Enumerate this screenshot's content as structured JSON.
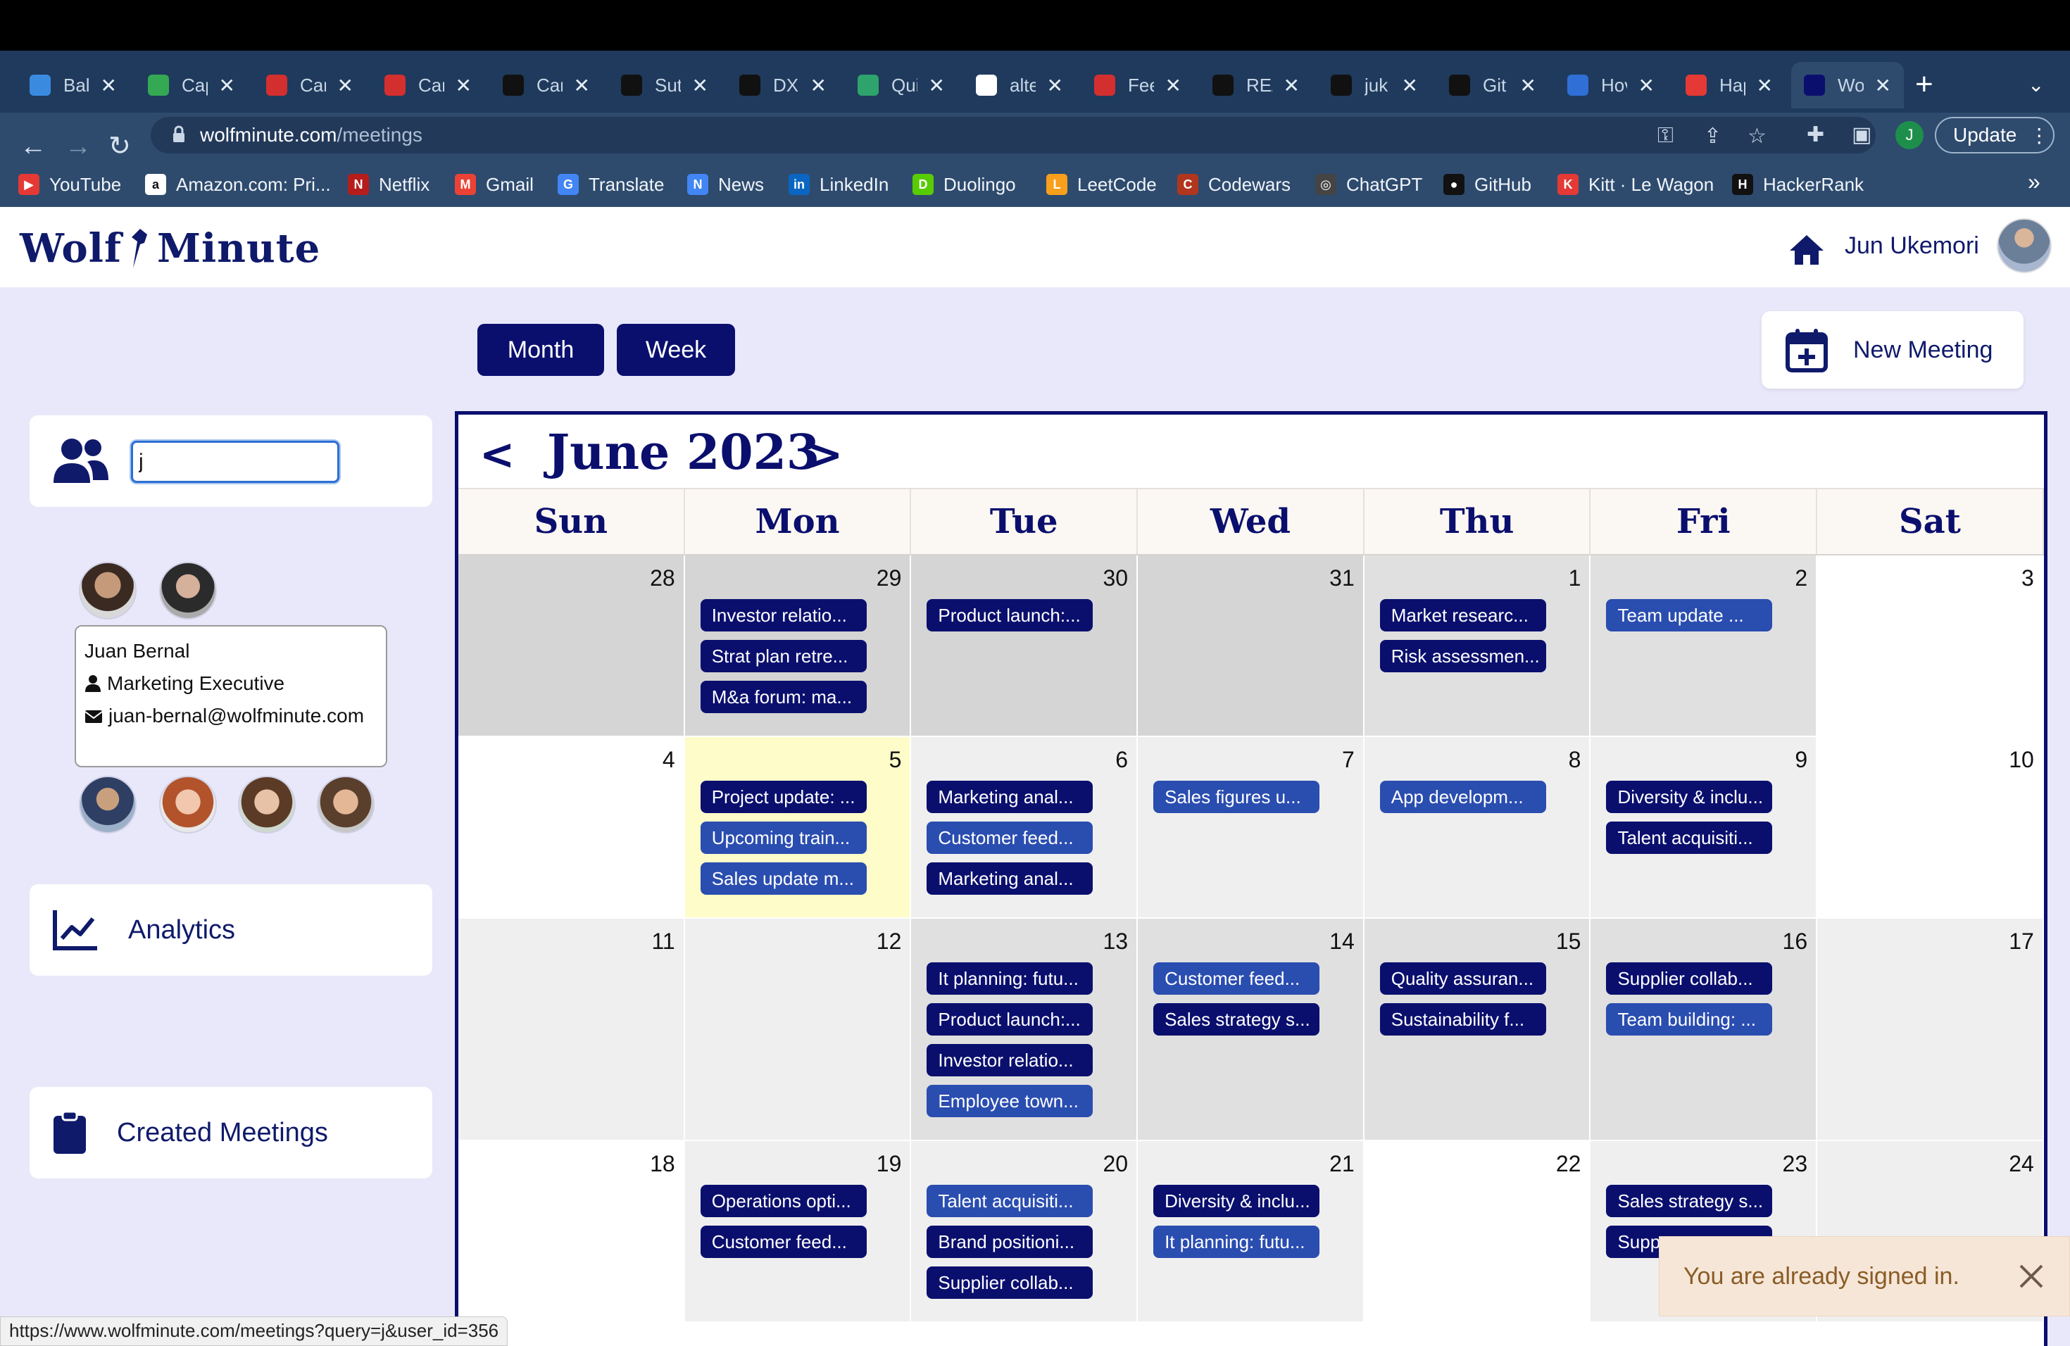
{
  "browser": {
    "tabs": [
      {
        "title": "Bali",
        "color": "#3a8be0"
      },
      {
        "title": "Cap",
        "color": "#34a853"
      },
      {
        "title": "Car",
        "color": "#d32f2f"
      },
      {
        "title": "Car",
        "color": "#d32f2f"
      },
      {
        "title": "Car",
        "color": "#111111"
      },
      {
        "title": "Sut",
        "color": "#111111"
      },
      {
        "title": "DX",
        "color": "#111111"
      },
      {
        "title": "Qui",
        "color": "#2ea36b"
      },
      {
        "title": "alte",
        "color": "#ffffff"
      },
      {
        "title": "Fee",
        "color": "#d32f2f"
      },
      {
        "title": "RE/",
        "color": "#111111"
      },
      {
        "title": "juk",
        "color": "#111111"
      },
      {
        "title": "Git",
        "color": "#111111"
      },
      {
        "title": "Hov",
        "color": "#2f6fd6"
      },
      {
        "title": "Hap",
        "color": "#e53935"
      },
      {
        "title": "Wol",
        "color": "#0a0f6e"
      }
    ],
    "url_host": "wolfminute.com",
    "url_path": "/meetings",
    "update_label": "Update",
    "profile_initial": "J",
    "bookmarks": [
      {
        "label": "YouTube",
        "color": "#e53935",
        "glyph": "▶"
      },
      {
        "label": "Amazon.com: Pri...",
        "color": "#ffffff",
        "glyph": "a"
      },
      {
        "label": "Netflix",
        "color": "#b71c1c",
        "glyph": "N"
      },
      {
        "label": "Gmail",
        "color": "#ea4335",
        "glyph": "M"
      },
      {
        "label": "Translate",
        "color": "#4285f4",
        "glyph": "G"
      },
      {
        "label": "News",
        "color": "#4285f4",
        "glyph": "N"
      },
      {
        "label": "LinkedIn",
        "color": "#0a66c2",
        "glyph": "in"
      },
      {
        "label": "Duolingo",
        "color": "#58cc02",
        "glyph": "D"
      },
      {
        "label": "LeetCode",
        "color": "#f89f1b",
        "glyph": "L"
      },
      {
        "label": "Codewars",
        "color": "#b1361e",
        "glyph": "C"
      },
      {
        "label": "ChatGPT",
        "color": "#444444",
        "glyph": "◎"
      },
      {
        "label": "GitHub",
        "color": "#111111",
        "glyph": "●"
      },
      {
        "label": "Kitt · Le Wagon",
        "color": "#e53935",
        "glyph": "K"
      },
      {
        "label": "HackerRank",
        "color": "#111111",
        "glyph": "H"
      }
    ],
    "status_url": "https://www.wolfminute.com/meetings?query=j&user_id=356"
  },
  "header": {
    "logo_left": "Wolf",
    "logo_right": "Minute",
    "user_name": "Jun Ukemori"
  },
  "views": {
    "month_label": "Month",
    "week_label": "Week",
    "new_meeting_label": "New Meeting"
  },
  "sidebar": {
    "search_value": "j",
    "tooltip": {
      "name": "Juan Bernal",
      "role": "Marketing Executive",
      "email": "juan-bernal@wolfminute.com"
    },
    "analytics_label": "Analytics",
    "created_label": "Created Meetings"
  },
  "calendar": {
    "title": "June 2023",
    "prev": "<",
    "next": ">",
    "days": [
      "Sun",
      "Mon",
      "Tue",
      "Wed",
      "Thu",
      "Fri",
      "Sat"
    ],
    "weeks": [
      [
        {
          "day": "28",
          "bg": "#d5d5d5",
          "events": []
        },
        {
          "day": "29",
          "bg": "#d5d5d5",
          "events": [
            {
              "t": "Investor relatio...",
              "k": "dark"
            },
            {
              "t": "Strat plan retre...",
              "k": "dark"
            },
            {
              "t": "M&a forum: ma...",
              "k": "dark"
            }
          ]
        },
        {
          "day": "30",
          "bg": "#d5d5d5",
          "events": [
            {
              "t": "Product launch:...",
              "k": "dark"
            }
          ]
        },
        {
          "day": "31",
          "bg": "#d5d5d5",
          "events": []
        },
        {
          "day": "1",
          "bg": "#e0e0e0",
          "events": [
            {
              "t": "Market researc...",
              "k": "dark"
            },
            {
              "t": "Risk assessmen...",
              "k": "dark"
            }
          ]
        },
        {
          "day": "2",
          "bg": "#e0e0e0",
          "events": [
            {
              "t": "Team update ...",
              "k": "light"
            }
          ]
        },
        {
          "day": "3",
          "bg": "#ffffff",
          "events": []
        }
      ],
      [
        {
          "day": "4",
          "bg": "#ffffff",
          "events": []
        },
        {
          "day": "5",
          "bg": "#fefdc9",
          "events": [
            {
              "t": "Project update: ...",
              "k": "dark"
            },
            {
              "t": "Upcoming train...",
              "k": "light"
            },
            {
              "t": "Sales update m...",
              "k": "light"
            }
          ]
        },
        {
          "day": "6",
          "bg": "#efefef",
          "events": [
            {
              "t": "Marketing anal...",
              "k": "dark"
            },
            {
              "t": "Customer feed...",
              "k": "light"
            },
            {
              "t": "Marketing anal...",
              "k": "dark"
            }
          ]
        },
        {
          "day": "7",
          "bg": "#efefef",
          "events": [
            {
              "t": "Sales figures u...",
              "k": "light"
            }
          ]
        },
        {
          "day": "8",
          "bg": "#efefef",
          "events": [
            {
              "t": "App developm...",
              "k": "light"
            }
          ]
        },
        {
          "day": "9",
          "bg": "#efefef",
          "events": [
            {
              "t": "Diversity & inclu...",
              "k": "dark"
            },
            {
              "t": "Talent acquisiti...",
              "k": "dark"
            }
          ]
        },
        {
          "day": "10",
          "bg": "#ffffff",
          "events": []
        }
      ],
      [
        {
          "day": "11",
          "bg": "#efefef",
          "events": []
        },
        {
          "day": "12",
          "bg": "#efefef",
          "events": []
        },
        {
          "day": "13",
          "bg": "#e0e0e0",
          "events": [
            {
              "t": "It planning: futu...",
              "k": "dark"
            },
            {
              "t": "Product launch:...",
              "k": "dark"
            },
            {
              "t": "Investor relatio...",
              "k": "dark"
            },
            {
              "t": "Employee town...",
              "k": "light"
            }
          ]
        },
        {
          "day": "14",
          "bg": "#e0e0e0",
          "events": [
            {
              "t": "Customer feed...",
              "k": "light"
            },
            {
              "t": "Sales strategy s...",
              "k": "dark"
            }
          ]
        },
        {
          "day": "15",
          "bg": "#e0e0e0",
          "events": [
            {
              "t": "Quality assuran...",
              "k": "dark"
            },
            {
              "t": "Sustainability f...",
              "k": "dark"
            }
          ]
        },
        {
          "day": "16",
          "bg": "#e0e0e0",
          "events": [
            {
              "t": "Supplier collab...",
              "k": "dark"
            },
            {
              "t": "Team building: ...",
              "k": "light"
            }
          ]
        },
        {
          "day": "17",
          "bg": "#efefef",
          "events": []
        }
      ],
      [
        {
          "day": "18",
          "bg": "#ffffff",
          "events": []
        },
        {
          "day": "19",
          "bg": "#efefef",
          "events": [
            {
              "t": "Operations opti...",
              "k": "dark"
            },
            {
              "t": "Customer feed...",
              "k": "dark"
            }
          ]
        },
        {
          "day": "20",
          "bg": "#efefef",
          "events": [
            {
              "t": "Talent acquisiti...",
              "k": "light"
            },
            {
              "t": "Brand positioni...",
              "k": "dark"
            },
            {
              "t": "Supplier collab...",
              "k": "dark"
            }
          ]
        },
        {
          "day": "21",
          "bg": "#efefef",
          "events": [
            {
              "t": "Diversity & inclu...",
              "k": "dark"
            },
            {
              "t": "It planning: futu...",
              "k": "light"
            }
          ]
        },
        {
          "day": "22",
          "bg": "#ffffff",
          "events": []
        },
        {
          "day": "23",
          "bg": "#efefef",
          "events": [
            {
              "t": "Sales strategy s...",
              "k": "dark"
            },
            {
              "t": "Supp",
              "k": "dark"
            }
          ]
        },
        {
          "day": "24",
          "bg": "#efefef",
          "events": []
        }
      ]
    ]
  },
  "toast": {
    "message": "You are already signed in."
  }
}
